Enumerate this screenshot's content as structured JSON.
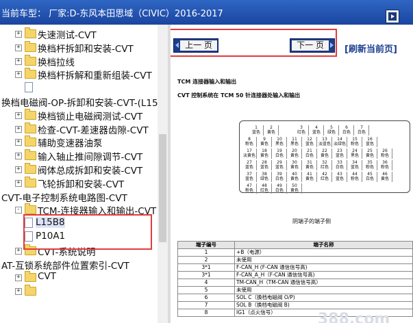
{
  "header": {
    "title": "当前车型：  厂家:D-东风本田思域（CIVIC）2016-2017"
  },
  "tree": [
    {
      "label": "失速测试-CVT",
      "type": "folder",
      "indent": 1,
      "expander": "+"
    },
    {
      "label": "换档杆拆卸和安装-CVT",
      "type": "folder",
      "indent": 1,
      "expander": "+"
    },
    {
      "label": "换档拉线",
      "type": "folder",
      "indent": 1,
      "expander": "+"
    },
    {
      "label": "换档杆拆解和重新组装-CVT",
      "type": "folder",
      "indent": 1,
      "expander": "+"
    },
    {
      "label": "",
      "type": "doc",
      "indent": 2,
      "expander": ""
    },
    {
      "label": "换档电磁阀-OP-拆卸和安装-CVT-(L15B",
      "type": "none",
      "indent": 0,
      "expander": ""
    },
    {
      "label": "换档锁止电磁阀测试-CVT",
      "type": "folder",
      "indent": 1,
      "expander": "+"
    },
    {
      "label": "检查-CVT-差速器齿隙-CVT",
      "type": "folder",
      "indent": 1,
      "expander": "+"
    },
    {
      "label": "辅助变速器油泵",
      "type": "folder",
      "indent": 1,
      "expander": "+"
    },
    {
      "label": "输入轴止推间隙调节-CVT",
      "type": "folder",
      "indent": 1,
      "expander": "+"
    },
    {
      "label": "阀体总成拆卸和安装-CVT",
      "type": "folder",
      "indent": 1,
      "expander": "+"
    },
    {
      "label": "飞轮拆卸和安装-CVT",
      "type": "folder",
      "indent": 1,
      "expander": "+"
    },
    {
      "label": "CVT-电子控制系统电路图-CVT",
      "type": "none",
      "indent": 0,
      "expander": ""
    },
    {
      "label": "TCM-连接器输入和输出-CVT",
      "type": "folder",
      "indent": 1,
      "expander": "-"
    },
    {
      "label": "L15B8",
      "type": "doc",
      "indent": 2,
      "expander": "",
      "selected": true
    },
    {
      "label": "P10A1",
      "type": "doc",
      "indent": 2,
      "expander": ""
    },
    {
      "label": "CVT-系统说明",
      "type": "folder",
      "indent": 1,
      "expander": "+"
    },
    {
      "label": "AT-互锁系统部件位置索引-CVT",
      "type": "none",
      "indent": 0,
      "expander": ""
    },
    {
      "label": "CVT",
      "type": "folder",
      "indent": 1,
      "expander": "+"
    },
    {
      "label": "",
      "type": "folder",
      "indent": 1,
      "expander": "+"
    }
  ],
  "nav": {
    "prev_label": "上一 页",
    "next_label": "下一 页",
    "refresh_label": "[刷新当前页]"
  },
  "document": {
    "heading": "TCM 连接器输入和输出",
    "subheading": "CVT 控制系统在  TCM 50 针连接器处输入和输出",
    "connector_caption": "阴端子的端子侧",
    "pins_row1": [
      [
        "1",
        "蓝色"
      ],
      [
        "2",
        "黄色"
      ],
      [
        "",
        ""
      ],
      [
        "3",
        "红色"
      ],
      [
        "4",
        "蓝色"
      ],
      [
        "5",
        "绿色"
      ],
      [
        "6",
        "白色"
      ],
      [
        "7",
        "白色"
      ]
    ],
    "pins_row2": [
      [
        "8",
        "粉色"
      ],
      [
        "9",
        "黄色"
      ],
      [
        "10",
        "黑色"
      ],
      [
        "11",
        "黑色"
      ],
      [
        "12",
        "蓝色"
      ],
      [
        "13",
        "淡蓝色"
      ],
      [
        "14",
        "淡绿色"
      ],
      [
        "15",
        "粉色"
      ],
      [
        "16",
        "蓝色"
      ]
    ],
    "pins_row3": [
      [
        "17",
        "淡黄色"
      ],
      [
        "18",
        "黄色"
      ],
      [
        "19",
        "白色"
      ],
      [
        "20",
        "黄色"
      ],
      [
        "21",
        "白色"
      ],
      [
        "22",
        "黄色"
      ],
      [
        "23",
        "蓝色"
      ],
      [
        "24",
        "黑色"
      ],
      [
        "25",
        "黄色"
      ],
      [
        "26",
        "粉色"
      ]
    ],
    "pins_row4": [
      [
        "27",
        "蓝色"
      ],
      [
        "28",
        "蓝色"
      ],
      [
        "29",
        "蓝色"
      ],
      [
        "30",
        "黄色"
      ],
      [
        "31",
        "黄色"
      ],
      [
        "32",
        "红色"
      ],
      [
        "33",
        "白色"
      ],
      [
        "34",
        "蓝色"
      ],
      [
        "35",
        "粉色"
      ],
      [
        "36",
        "粉色"
      ]
    ],
    "pins_row5": [
      [
        "37",
        "蓝色"
      ],
      [
        "38",
        "绿色"
      ],
      [
        "39",
        "白色"
      ],
      [
        "40",
        "黄色"
      ],
      [
        "41",
        "黄色"
      ],
      [
        "42",
        "红色"
      ],
      [
        "43",
        "蓝色"
      ],
      [
        "44",
        "粉色"
      ],
      [
        "45",
        "白色"
      ],
      [
        "46",
        "黄色"
      ]
    ],
    "pins_row6": [
      [
        "47",
        "粉色"
      ],
      [
        "48",
        "红色"
      ],
      [
        "49",
        "白色"
      ],
      [
        "50",
        "黄色"
      ]
    ],
    "table_headers": [
      "端子编号",
      "端子名称"
    ],
    "table_rows": [
      [
        "1",
        "+B（电源）"
      ],
      [
        "2",
        "未使用"
      ],
      [
        "3*1",
        "F-CAN_H (F-CAN 通信信号高)"
      ],
      [
        "3*1",
        "F-CAN_A_H（F-CAN 通信信号高)"
      ],
      [
        "4",
        "TM-CAN_H（TM-CAN 通信信号高）"
      ],
      [
        "5",
        "未使用"
      ],
      [
        "6",
        "SOL C（换档电磁阀 O/P)"
      ],
      [
        "7",
        "SOL B（换档电磁阀 B)"
      ],
      [
        "8",
        "IG1（点火信号）"
      ]
    ],
    "watermark": "388.com"
  },
  "colors": {
    "header_bg": "#1a45a0",
    "nav_button": "#1d3d8a",
    "highlight_box": "#e23b3b",
    "refresh_text": "#1a3d8f"
  }
}
